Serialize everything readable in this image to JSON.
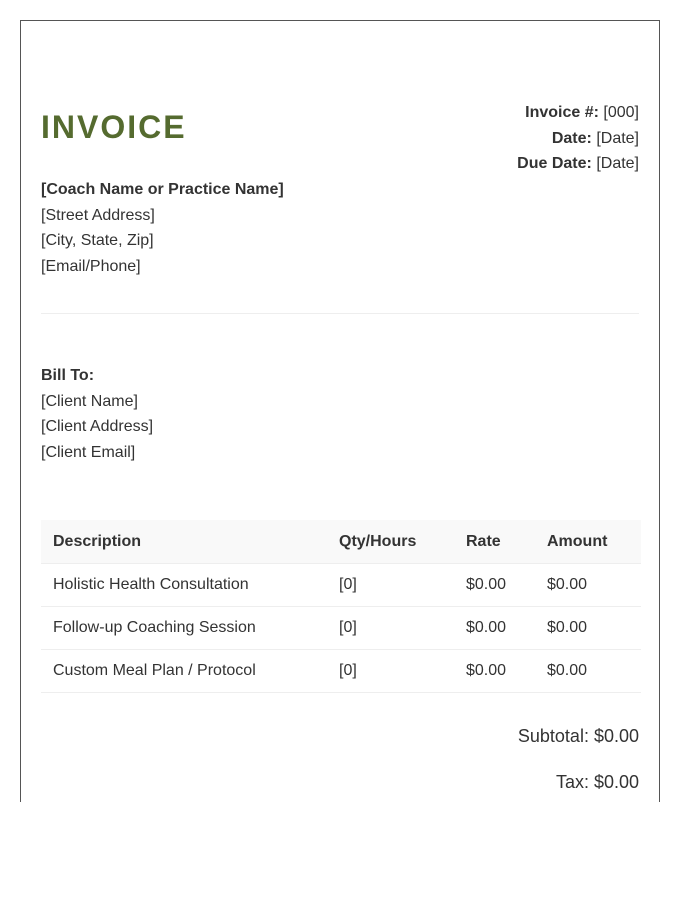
{
  "invoice": {
    "title": "INVOICE",
    "number_label": "Invoice #:",
    "number_value": "[000]",
    "date_label": "Date:",
    "date_value": "[Date]",
    "due_label": "Due Date:",
    "due_value": "[Date]"
  },
  "from": {
    "name": "[Coach Name or Practice Name]",
    "street": "[Street Address]",
    "city": "[City, State, Zip]",
    "contact": "[Email/Phone]"
  },
  "bill_to": {
    "label": "Bill To:",
    "client_name": "[Client Name]",
    "client_address": "[Client Address]",
    "client_email": "[Client Email]"
  },
  "table": {
    "headers": [
      "Description",
      "Qty/Hours",
      "Rate",
      "Amount"
    ],
    "rows": [
      [
        "Holistic Health Consultation",
        "[0]",
        "$0.00",
        "$0.00"
      ],
      [
        "Follow-up Coaching Session",
        "[0]",
        "$0.00",
        "$0.00"
      ],
      [
        "Custom Meal Plan / Protocol",
        "[0]",
        "$0.00",
        "$0.00"
      ]
    ]
  },
  "totals": {
    "subtotal": "Subtotal: $0.00",
    "tax": "Tax: $0.00"
  },
  "colors": {
    "accent": "#556b2f",
    "text": "#333333"
  }
}
